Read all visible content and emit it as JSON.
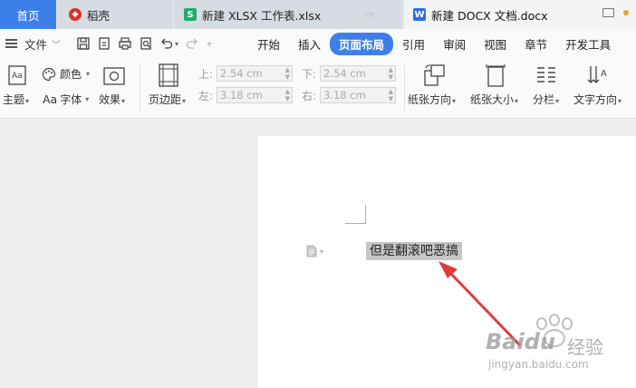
{
  "tabs": {
    "home": "首页",
    "docer": "稻壳",
    "xlsx": "新建 XLSX 工作表.xlsx",
    "docx": "新建 DOCX 文档.docx",
    "xlsx_icon": "S",
    "docx_icon": "W"
  },
  "menu": {
    "file": "文件",
    "tabs": [
      "开始",
      "插入",
      "页面布局",
      "引用",
      "审阅",
      "视图",
      "章节",
      "开发工具"
    ],
    "active": "页面布局"
  },
  "ribbon": {
    "theme_color": "颜色",
    "theme": "主题",
    "font": "字体",
    "font_prefix": "Aa",
    "effect": "效果",
    "margins": "页边距",
    "top_label": "上:",
    "top_value": "2.54 cm",
    "bottom_label": "下:",
    "bottom_value": "2.54 cm",
    "left_label": "左:",
    "left_value": "3.18 cm",
    "right_label": "右:",
    "right_value": "3.18 cm",
    "orientation": "纸张方向",
    "size": "纸张大小",
    "columns": "分栏",
    "text_direction": "文字方向"
  },
  "document": {
    "selected_text": "但是翻滚吧恶搞"
  },
  "watermark": {
    "brand": "Baidu",
    "brand_cn": "经验",
    "url": "jingyan.baidu.com"
  },
  "colors": {
    "accent": "#3d7fe9",
    "arrow": "#e03c3c",
    "selection": "#c6c6c6"
  }
}
